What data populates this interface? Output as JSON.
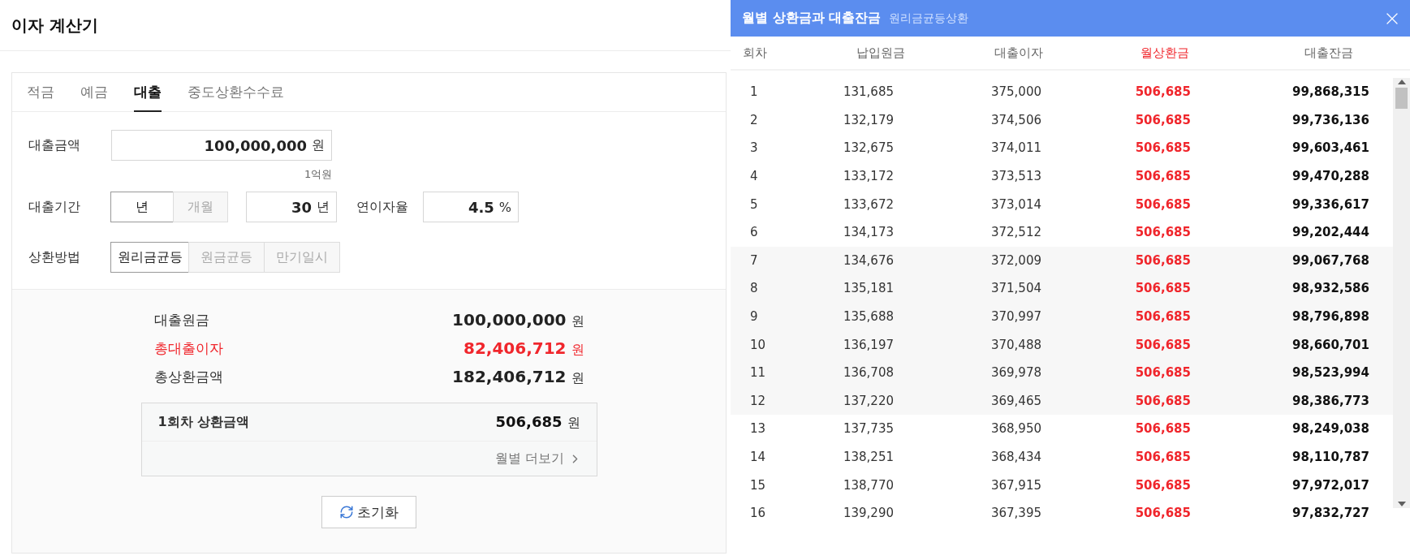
{
  "title": "이자 계산기",
  "tabs": [
    {
      "label": "적금",
      "selected": false
    },
    {
      "label": "예금",
      "selected": false
    },
    {
      "label": "대출",
      "selected": true
    },
    {
      "label": "중도상환수수료",
      "selected": false
    }
  ],
  "form": {
    "amount": {
      "label": "대출금액",
      "value": "100,000,000",
      "unit": "원",
      "hint": "1억원"
    },
    "period": {
      "label": "대출기간",
      "units": [
        {
          "label": "년",
          "selected": true
        },
        {
          "label": "개월",
          "selected": false
        }
      ],
      "value": "30",
      "unit": "년"
    },
    "rate": {
      "label": "연이자율",
      "value": "4.5",
      "unit": "%"
    },
    "method": {
      "label": "상환방법",
      "options": [
        {
          "label": "원리금균등",
          "selected": true
        },
        {
          "label": "원금균등",
          "selected": false
        },
        {
          "label": "만기일시",
          "selected": false
        }
      ]
    }
  },
  "summary": [
    {
      "label": "대출원금",
      "value": "100,000,000",
      "unit": "원",
      "highlight": false
    },
    {
      "label": "총대출이자",
      "value": "82,406,712",
      "unit": "원",
      "highlight": true
    },
    {
      "label": "총상환금액",
      "value": "182,406,712",
      "unit": "원",
      "highlight": false
    }
  ],
  "first_payment": {
    "label": "1회차 상환금액",
    "value": "506,685",
    "unit": "원",
    "link": "월별 더보기"
  },
  "reset_button": "초기화",
  "schedule": {
    "title": "월별 상환금과 대출잔금",
    "subtitle": "원리금균등상환",
    "columns": [
      {
        "label": "회차",
        "highlight": false
      },
      {
        "label": "납입원금",
        "highlight": false
      },
      {
        "label": "대출이자",
        "highlight": false
      },
      {
        "label": "월상환금",
        "highlight": true
      },
      {
        "label": "대출잔금",
        "highlight": false
      }
    ],
    "rows": [
      {
        "cells": [
          "1",
          "131,685",
          "375,000",
          "506,685",
          "99,868,315"
        ],
        "shaded": false
      },
      {
        "cells": [
          "2",
          "132,179",
          "374,506",
          "506,685",
          "99,736,136"
        ],
        "shaded": false
      },
      {
        "cells": [
          "3",
          "132,675",
          "374,011",
          "506,685",
          "99,603,461"
        ],
        "shaded": false
      },
      {
        "cells": [
          "4",
          "133,172",
          "373,513",
          "506,685",
          "99,470,288"
        ],
        "shaded": false
      },
      {
        "cells": [
          "5",
          "133,672",
          "373,014",
          "506,685",
          "99,336,617"
        ],
        "shaded": false
      },
      {
        "cells": [
          "6",
          "134,173",
          "372,512",
          "506,685",
          "99,202,444"
        ],
        "shaded": false
      },
      {
        "cells": [
          "7",
          "134,676",
          "372,009",
          "506,685",
          "99,067,768"
        ],
        "shaded": true
      },
      {
        "cells": [
          "8",
          "135,181",
          "371,504",
          "506,685",
          "98,932,586"
        ],
        "shaded": true
      },
      {
        "cells": [
          "9",
          "135,688",
          "370,997",
          "506,685",
          "98,796,898"
        ],
        "shaded": true
      },
      {
        "cells": [
          "10",
          "136,197",
          "370,488",
          "506,685",
          "98,660,701"
        ],
        "shaded": true
      },
      {
        "cells": [
          "11",
          "136,708",
          "369,978",
          "506,685",
          "98,523,994"
        ],
        "shaded": true
      },
      {
        "cells": [
          "12",
          "137,220",
          "369,465",
          "506,685",
          "98,386,773"
        ],
        "shaded": true
      },
      {
        "cells": [
          "13",
          "137,735",
          "368,950",
          "506,685",
          "98,249,038"
        ],
        "shaded": false
      },
      {
        "cells": [
          "14",
          "138,251",
          "368,434",
          "506,685",
          "98,110,787"
        ],
        "shaded": false
      },
      {
        "cells": [
          "15",
          "138,770",
          "367,915",
          "506,685",
          "97,972,017"
        ],
        "shaded": false
      },
      {
        "cells": [
          "16",
          "139,290",
          "367,395",
          "506,685",
          "97,832,727"
        ],
        "shaded": false
      }
    ]
  }
}
